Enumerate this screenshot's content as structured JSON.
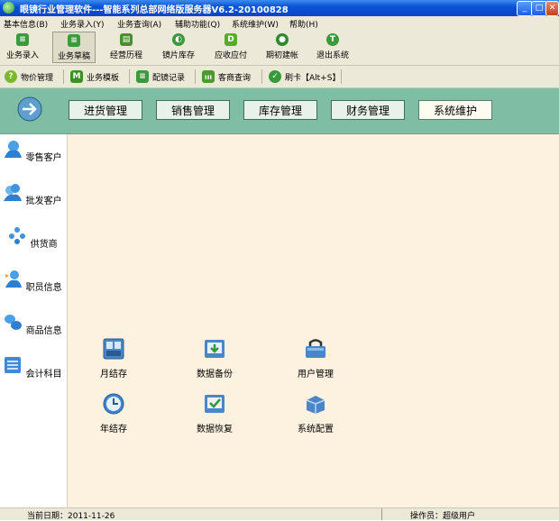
{
  "window": {
    "title": "眼镜行业管理软件---智能系列总部网络版服务器V6.2-20100828",
    "controls": [
      "minimize-icon",
      "maximize-icon",
      "close-icon"
    ]
  },
  "menu": [
    "基本信息(B)",
    "业务录入(Y)",
    "业务查询(A)",
    "辅助功能(Q)",
    "系统维护(W)",
    "帮助(H)"
  ],
  "toolbar1": [
    {
      "label": "业务录入",
      "icon": "entry-icon"
    },
    {
      "label": "业务草稿",
      "icon": "draft-icon",
      "pressed": true
    },
    {
      "label": "经营历程",
      "icon": "history-icon"
    },
    {
      "label": "镜片库存",
      "icon": "lens-stock-icon"
    },
    {
      "label": "应收应付",
      "icon": "receivable-icon"
    },
    {
      "label": "期初建帐",
      "icon": "opening-account-icon"
    },
    {
      "label": "退出系统",
      "icon": "exit-icon"
    }
  ],
  "toolbar2": [
    {
      "label": "物价管理",
      "icon": "price-icon",
      "glyph": "?"
    },
    {
      "label": "业务模板",
      "icon": "template-icon",
      "glyph": "M"
    },
    {
      "label": "配镜记录",
      "icon": "record-icon",
      "glyph": "≡"
    },
    {
      "label": "客商查询",
      "icon": "query-icon",
      "glyph": "ııı"
    },
    {
      "label": "刷卡【Alt+S】",
      "icon": "card-icon",
      "glyph": "✓"
    }
  ],
  "nav_tabs": [
    {
      "label": "进货管理",
      "active": false
    },
    {
      "label": "销售管理",
      "active": false
    },
    {
      "label": "库存管理",
      "active": false
    },
    {
      "label": "财务管理",
      "active": false
    },
    {
      "label": "系统维护",
      "active": true
    }
  ],
  "sidebar": [
    {
      "label": "零售客户",
      "icon": "retail-customer-icon"
    },
    {
      "label": "批发客户",
      "icon": "wholesale-customer-icon"
    },
    {
      "label": "供货商",
      "icon": "supplier-icon"
    },
    {
      "label": "职员信息",
      "icon": "staff-icon"
    },
    {
      "label": "商品信息",
      "icon": "product-icon"
    },
    {
      "label": "会计科目",
      "icon": "accounting-icon"
    }
  ],
  "main_items": [
    {
      "label": "月结存",
      "icon": "monthly-close-icon"
    },
    {
      "label": "数据备份",
      "icon": "data-backup-icon"
    },
    {
      "label": "用户管理",
      "icon": "user-management-icon"
    },
    {
      "label": "年结存",
      "icon": "yearly-close-icon"
    },
    {
      "label": "数据恢复",
      "icon": "data-restore-icon"
    },
    {
      "label": "系统配置",
      "icon": "system-config-icon"
    }
  ],
  "status": {
    "date": "当前日期：2011-11-26",
    "operator": "操作员：超级用户"
  },
  "colors": {
    "titlebar": "#0a53d6",
    "navband": "#7fbda4",
    "main_bg": "#fdf1df",
    "chrome": "#ece9d8"
  }
}
